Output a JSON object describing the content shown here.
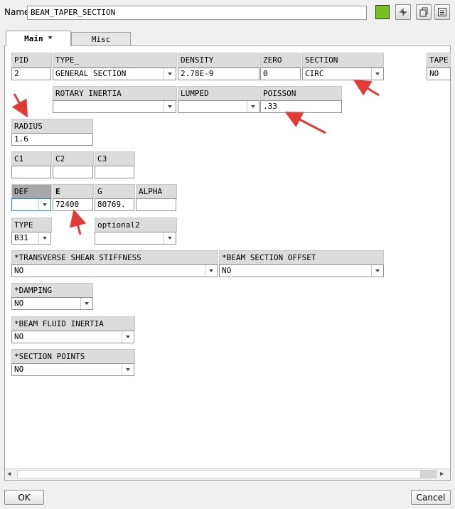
{
  "header": {
    "name_label": "Name",
    "name_value": "BEAM_TAPER_SECTION",
    "swatch_color": "#76c11a"
  },
  "tabs": [
    {
      "label": "Main *"
    },
    {
      "label": "Misc"
    }
  ],
  "fields": {
    "pid": {
      "label": "PID",
      "value": "2"
    },
    "type_": {
      "label": "TYPE_",
      "value": "GENERAL SECTION"
    },
    "density": {
      "label": "DENSITY",
      "value": "2.78E-9"
    },
    "zero": {
      "label": "ZERO",
      "value": "0"
    },
    "section": {
      "label": "SECTION",
      "value": "CIRC"
    },
    "tape": {
      "label": "TAPE",
      "value": "NO"
    },
    "rotary_inertia": {
      "label": "ROTARY INERTIA",
      "value": ""
    },
    "lumped": {
      "label": "LUMPED",
      "value": ""
    },
    "poisson": {
      "label": "POISSON",
      "value": ".33"
    },
    "radius": {
      "label": "RADIUS",
      "value": "1.6"
    },
    "c1": {
      "label": "C1",
      "value": ""
    },
    "c2": {
      "label": "C2",
      "value": ""
    },
    "c3": {
      "label": "C3",
      "value": ""
    },
    "def": {
      "label": "DEF",
      "value": ""
    },
    "e": {
      "label": "E",
      "value": "72400"
    },
    "g": {
      "label": "G",
      "value": "80769."
    },
    "alpha": {
      "label": "ALPHA",
      "value": ""
    },
    "type": {
      "label": "TYPE",
      "value": "B31"
    },
    "optional2": {
      "label": "optional2",
      "value": ""
    },
    "transverse": {
      "label": "*TRANSVERSE SHEAR STIFFNESS",
      "value": "NO"
    },
    "offset": {
      "label": "*BEAM SECTION OFFSET",
      "value": "NO"
    },
    "damping": {
      "label": "*DAMPING",
      "value": "NO"
    },
    "fluid": {
      "label": "*BEAM FLUID INERTIA",
      "value": "NO"
    },
    "points": {
      "label": "*SECTION POINTS",
      "value": "NO"
    }
  },
  "footer": {
    "ok": "OK",
    "cancel": "Cancel"
  },
  "annotation_color": "#e53935"
}
